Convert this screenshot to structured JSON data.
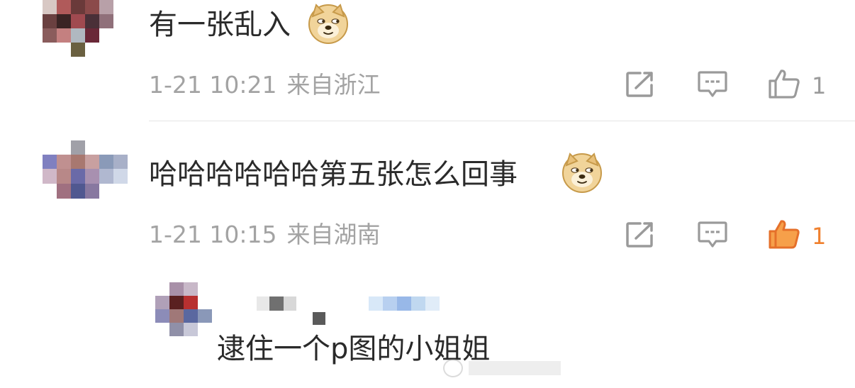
{
  "comments": [
    {
      "text": "有一张乱入",
      "emoji": "doge-emoji",
      "date": "1-21 10:21",
      "location": "来自浙江",
      "like_count": "1",
      "liked": false
    },
    {
      "text": "哈哈哈哈哈哈第五张怎么回事",
      "emoji": "doge-emoji",
      "date": "1-21 10:15",
      "location": "来自湖南",
      "like_count": "1",
      "liked": true
    }
  ],
  "reply": {
    "text": "逮住一个p图的小姐姐"
  },
  "icons": {
    "share": "share-icon",
    "comment": "comment-icon",
    "like": "thumbs-up-icon"
  },
  "colors": {
    "text": "#2a2a2a",
    "meta": "#a3a3a3",
    "icon": "#9a9a9a",
    "like_active": "#f0802d",
    "divider": "#e4e4e4"
  }
}
